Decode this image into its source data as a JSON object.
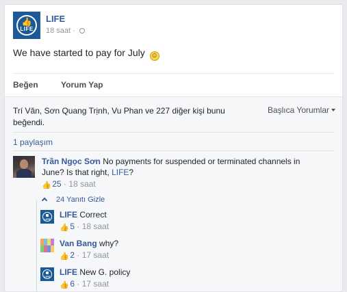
{
  "post": {
    "page_name": "LIFE",
    "logo_text": "LIFE",
    "time": "18 saat",
    "separator": "·",
    "text": "We have started to pay for July"
  },
  "actions": {
    "like": "Beğen",
    "comment": "Yorum Yap"
  },
  "feedback": {
    "likers": "Trí Văn, Sơn Quang Trịnh, Vu Phan ve 227 diğer kişi bunu beğendi.",
    "sort_label": "Başlıca Yorumlar",
    "shares": "1 paylaşım"
  },
  "comments": [
    {
      "author": "Trần Ngọc Sơn",
      "text_before": "No payments for suspended or terminated channels in June? Is that right, ",
      "mention": "LIFE",
      "text_after": "?",
      "likes": "25",
      "time": "18 saat",
      "dot": "·"
    }
  ],
  "replies_toggle": "24 Yanıtı Gizle",
  "replies": [
    {
      "author": "LIFE",
      "text": "Correct",
      "likes": "5",
      "time": "18 saat",
      "dot": "·"
    },
    {
      "author": "Van Bang",
      "text": "why?",
      "likes": "2",
      "time": "17 saat",
      "dot": "·"
    },
    {
      "author": "LIFE",
      "text": "New G. policy",
      "likes": "6",
      "time": "17 saat",
      "dot": "·"
    }
  ],
  "colors": {
    "link": "#365899",
    "page_bg": "#e9ebee",
    "logo": "#1b5a96"
  }
}
